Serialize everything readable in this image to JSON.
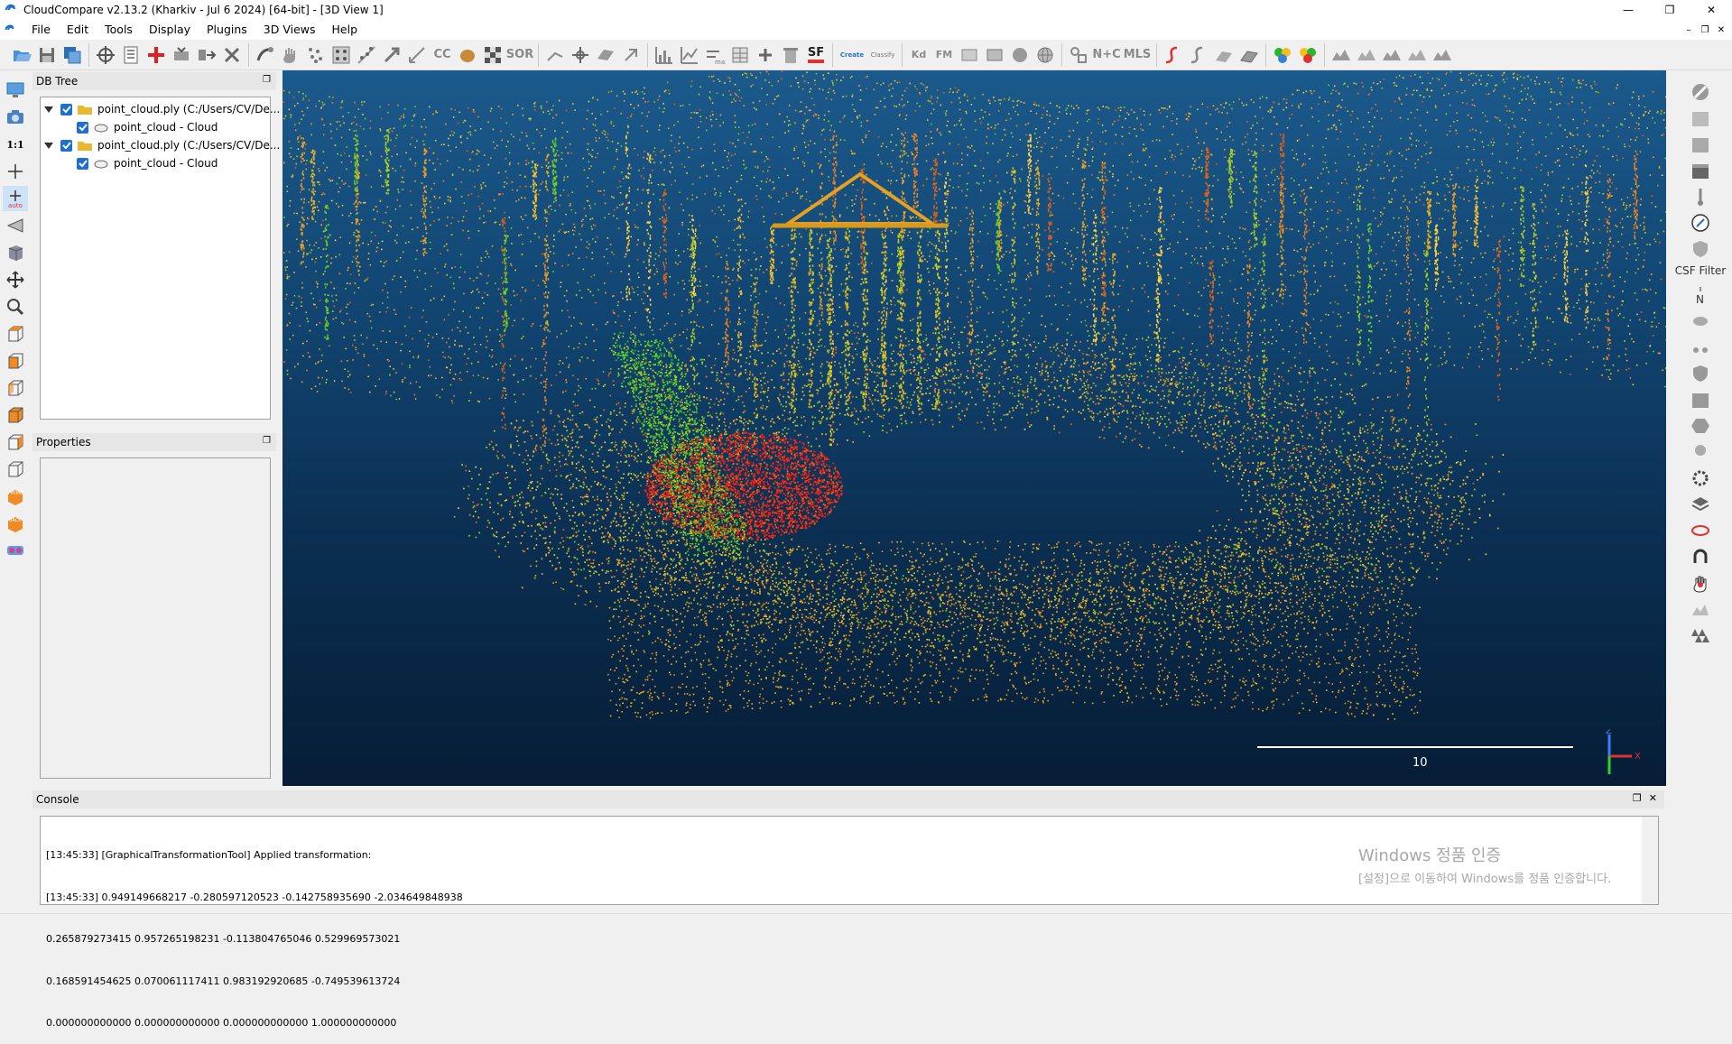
{
  "window": {
    "title": "CloudCompare v2.13.2 (Kharkiv - Jul  6 2024) [64-bit] - [3D View 1]",
    "minimize": "—",
    "maximize": "❐",
    "close": "✕"
  },
  "menu": {
    "items": [
      "File",
      "Edit",
      "Tools",
      "Display",
      "Plugins",
      "3D Views",
      "Help"
    ],
    "mdi_minimize": "–",
    "mdi_restore": "❐",
    "mdi_close": "✕"
  },
  "toolbar": {
    "sor_label": "SOR",
    "sf_label": "SF",
    "cc_label": "CC",
    "kd_label": "Kd",
    "fm_label": "FM",
    "nc_label": "N+C",
    "mls_label": "MLS",
    "canupo_create": "Create",
    "canupo_classify": "Classify",
    "max_label": "max"
  },
  "left_toolbar": {
    "one_to_one": "1:1",
    "auto_label": "auto",
    "front_label": "FRONT",
    "back_label": "BACK"
  },
  "db_tree": {
    "title": "DB Tree",
    "items": [
      {
        "label": "point_cloud.ply (C:/Users/CV/De...",
        "child": "point_cloud - Cloud"
      },
      {
        "label": "point_cloud.ply (C:/Users/CV/De...",
        "child": "point_cloud - Cloud"
      }
    ]
  },
  "properties": {
    "title": "Properties"
  },
  "view": {
    "scale_label": "10",
    "axis_z": "Z",
    "axis_x": "X"
  },
  "right_toolbar": {
    "csf_label": "CSF Filter",
    "n_label": "N"
  },
  "console": {
    "title": "Console",
    "lines": [
      "[13:45:33] [GraphicalTransformationTool] Applied transformation:",
      "[13:45:33] 0.949149668217 -0.280597120523 -0.142758935690 -2.034649848938",
      "0.265879273415 0.957265198231 -0.113804765046 0.529969573021",
      "0.168591454625 0.070061117411 0.983192920685 -0.749539613724",
      "0.000000000000 0.000000000000 0.000000000000 1.000000000000"
    ],
    "watermark_title": "Windows 정품 인증",
    "watermark_text": "[설정]으로 이동하여 Windows를 정품 인증합니다."
  }
}
